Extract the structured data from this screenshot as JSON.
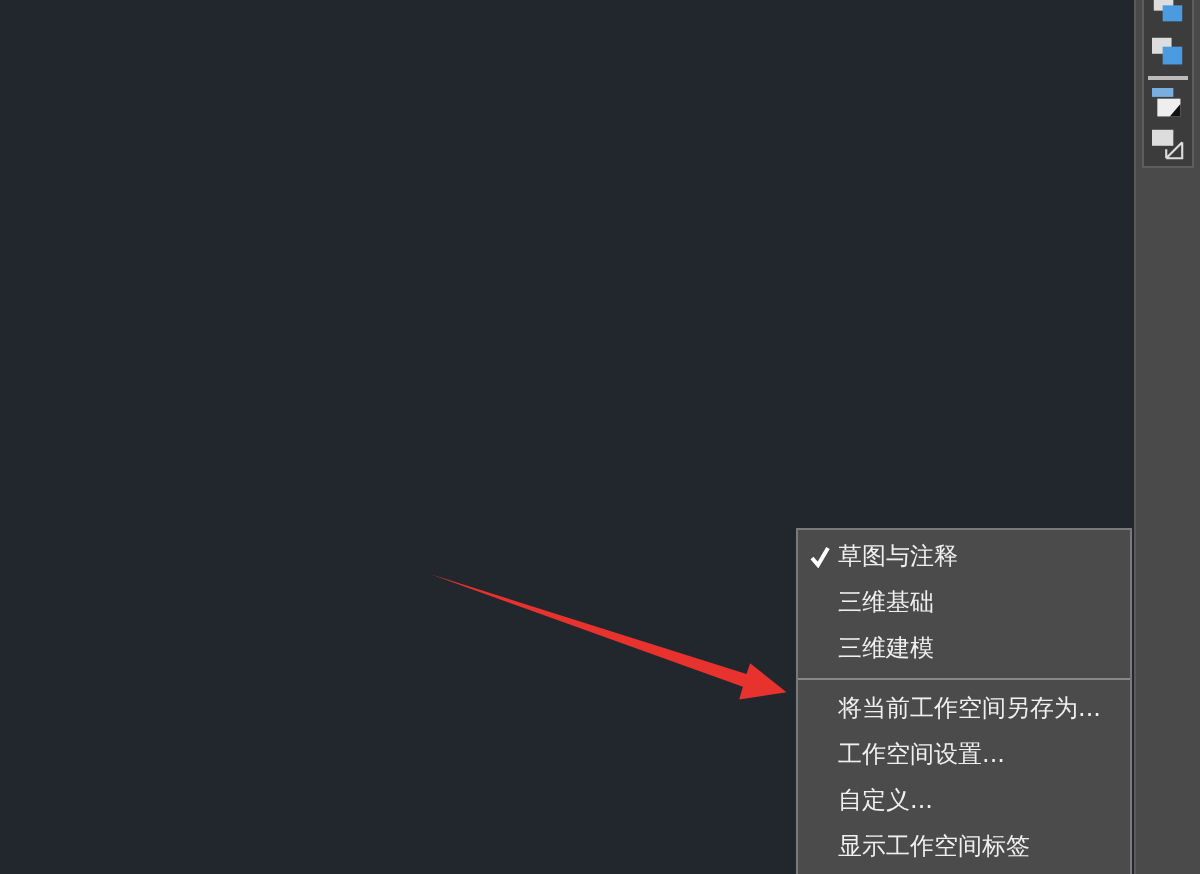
{
  "menu": {
    "groups": [
      {
        "items": [
          {
            "label": "草图与注释",
            "checked": true
          },
          {
            "label": "三维基础",
            "checked": false
          },
          {
            "label": "三维建模",
            "checked": false
          }
        ]
      },
      {
        "items": [
          {
            "label": "将当前工作空间另存为..."
          },
          {
            "label": "工作空间设置..."
          },
          {
            "label": "自定义..."
          },
          {
            "label": "显示工作空间标签"
          }
        ]
      }
    ]
  }
}
